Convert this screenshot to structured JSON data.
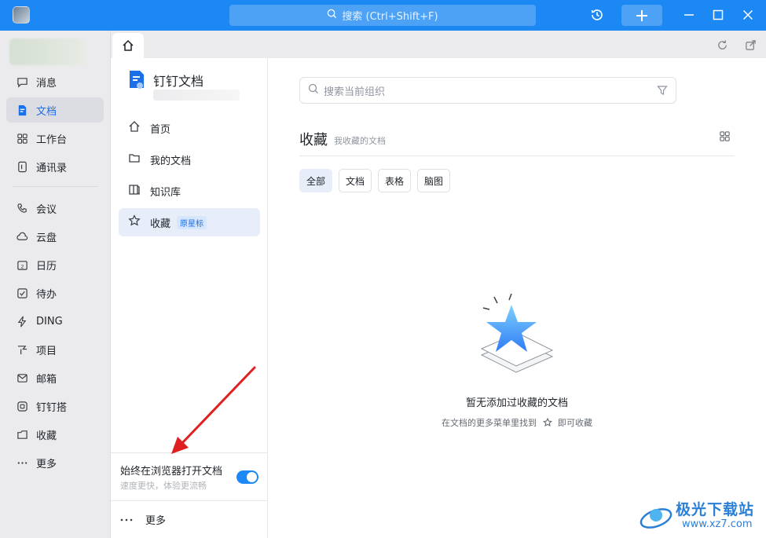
{
  "titlebar": {
    "search_placeholder": "搜索 (Ctrl+Shift+F)"
  },
  "sidebar": {
    "items": [
      {
        "label": "消息",
        "icon": "message-icon"
      },
      {
        "label": "文档",
        "icon": "document-icon",
        "active": true
      },
      {
        "label": "工作台",
        "icon": "grid-icon"
      },
      {
        "label": "通讯录",
        "icon": "contacts-icon"
      },
      {
        "label": "会议",
        "icon": "phone-icon"
      },
      {
        "label": "云盘",
        "icon": "cloud-icon"
      },
      {
        "label": "日历",
        "icon": "calendar-icon"
      },
      {
        "label": "待办",
        "icon": "checkbox-icon"
      },
      {
        "label": "DING",
        "icon": "lightning-icon"
      },
      {
        "label": "项目",
        "icon": "project-icon"
      },
      {
        "label": "邮箱",
        "icon": "mail-icon"
      },
      {
        "label": "钉钉搭",
        "icon": "builder-icon"
      },
      {
        "label": "收藏",
        "icon": "favorites-icon"
      },
      {
        "label": "更多",
        "icon": "more-icon"
      }
    ]
  },
  "docnav": {
    "title": "钉钉文档",
    "items": [
      {
        "label": "首页",
        "icon": "home-icon"
      },
      {
        "label": "我的文档",
        "icon": "folder-icon"
      },
      {
        "label": "知识库",
        "icon": "book-icon"
      },
      {
        "label": "收藏",
        "icon": "star-icon",
        "badge": "原星标",
        "active": true
      }
    ],
    "browser_toggle": {
      "title": "始终在浏览器打开文档",
      "subtitle": "速度更快，体验更流畅",
      "enabled": true
    },
    "more_label": "更多"
  },
  "main": {
    "search_placeholder": "搜索当前组织",
    "heading": "收藏",
    "subheading": "我收藏的文档",
    "filters": [
      "全部",
      "文档",
      "表格",
      "脑图"
    ],
    "active_filter": "全部",
    "empty_title": "暂无添加过收藏的文档",
    "empty_sub_before": "在文档的更多菜单里找到",
    "empty_sub_after": "即可收藏"
  },
  "watermark": {
    "line1": "极光下载站",
    "line2": "www.xz7.com"
  },
  "colors": {
    "accent": "#1b88f4",
    "active_text": "#1b6fe8",
    "annotation_arrow": "#e02020"
  }
}
